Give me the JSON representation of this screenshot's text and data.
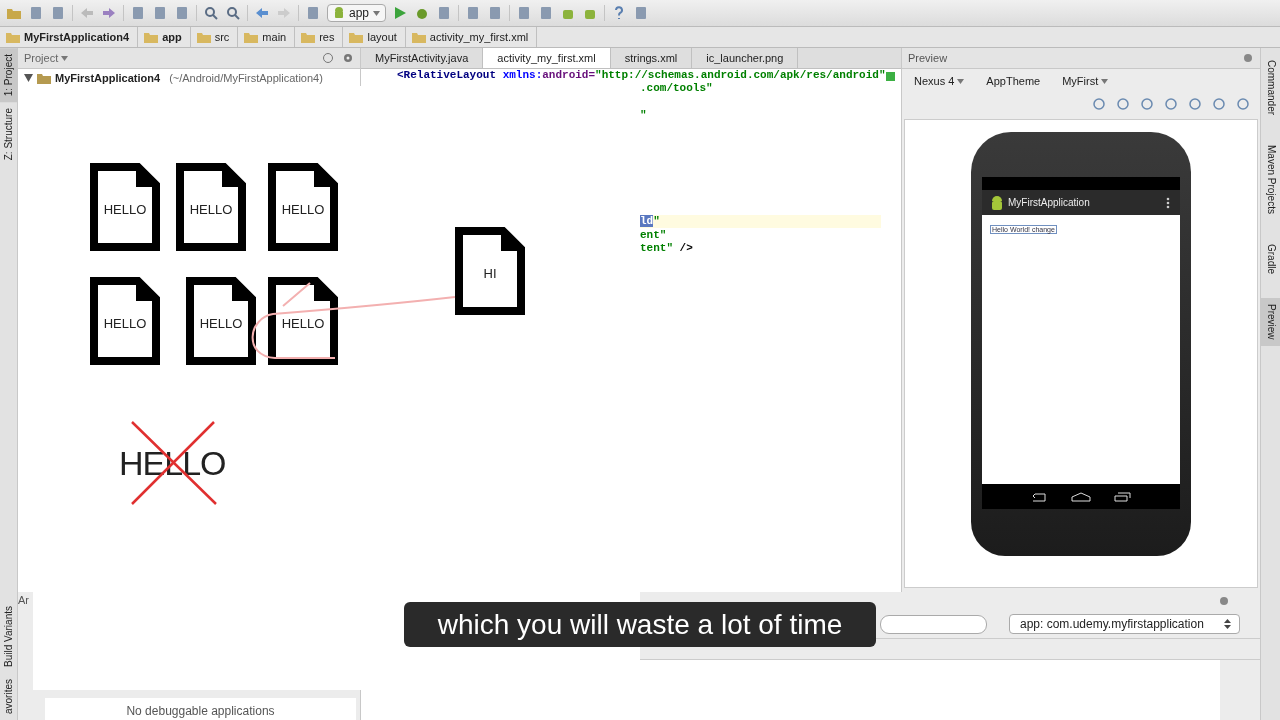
{
  "toolbar": {
    "run_config": "app"
  },
  "breadcrumbs": [
    {
      "label": "MyFirstApplication4",
      "bold": true
    },
    {
      "label": "app",
      "bold": true
    },
    {
      "label": "src",
      "bold": false
    },
    {
      "label": "main",
      "bold": false
    },
    {
      "label": "res",
      "bold": false
    },
    {
      "label": "layout",
      "bold": false
    },
    {
      "label": "activity_my_first.xml",
      "bold": false
    }
  ],
  "left_stripe": [
    {
      "label": "1: Project",
      "selected": true
    },
    {
      "label": "Z: Structure",
      "selected": false
    },
    {
      "label": "Build Variants",
      "selected": false
    },
    {
      "label": "avorites",
      "selected": false
    }
  ],
  "project_panel": {
    "title": "Project",
    "root": {
      "name": "MyFirstApplication4",
      "path": "(~/Android/MyFirstApplication4)",
      "expanded": true
    }
  },
  "editor": {
    "tabs": [
      {
        "label": "MyFirstActivity.java",
        "selected": false
      },
      {
        "label": "activity_my_first.xml",
        "selected": true
      },
      {
        "label": "strings.xml",
        "selected": false
      },
      {
        "label": "ic_launcher.png",
        "selected": false
      }
    ],
    "lines": [
      {
        "current": false,
        "tokens": [
          {
            "text": "<RelativeLayout",
            "kind": "tag"
          },
          {
            "text": " xmlns:",
            "kind": "attr"
          },
          {
            "text": "android=",
            "kind": "ns"
          },
          {
            "text": "\"http://schemas.android.com/apk/res/android\"",
            "kind": "value"
          }
        ]
      },
      {
        "current": false,
        "tokens": [
          {
            "text": ".com/tools\"",
            "kind": "value"
          }
        ]
      },
      {
        "current": false,
        "tokens": [
          {
            "text": "\"",
            "kind": "value"
          }
        ]
      },
      {
        "current": true,
        "tokens": [
          {
            "text": "ld",
            "kind": "selection"
          },
          {
            "text": "\"",
            "kind": "value"
          }
        ]
      },
      {
        "current": false,
        "tokens": [
          {
            "text": "ent\"",
            "kind": "value"
          }
        ]
      },
      {
        "current": false,
        "tokens": [
          {
            "text": "tent\"",
            "kind": "value"
          },
          {
            "text": " />",
            "kind": "plain"
          }
        ]
      }
    ]
  },
  "whiteboard": {
    "documents": [
      {
        "label": "HELLO"
      },
      {
        "label": "HELLO"
      },
      {
        "label": "HELLO"
      },
      {
        "label": "HELLO"
      },
      {
        "label": "HELLO"
      },
      {
        "label": "HELLO"
      },
      {
        "label": "HI"
      }
    ],
    "crossed_word": "HELLO"
  },
  "preview": {
    "title": "Preview",
    "device": "Nexus 4",
    "theme": "AppTheme",
    "activity": "MyFirst",
    "app_title": "MyFirstApplication",
    "text_view": "Hello World! change"
  },
  "right_stripe": [
    {
      "label": "Commander",
      "selected": false
    },
    {
      "label": "Maven Projects",
      "selected": false
    },
    {
      "label": "Gradle",
      "selected": false
    },
    {
      "label": "Preview",
      "selected": true
    }
  ],
  "bottom_panel": {
    "tab": "Ar",
    "process": "app: com.udemy.myfirstapplication",
    "devices_message": "No debuggable applications"
  },
  "caption": "which you will waste a lot of time"
}
